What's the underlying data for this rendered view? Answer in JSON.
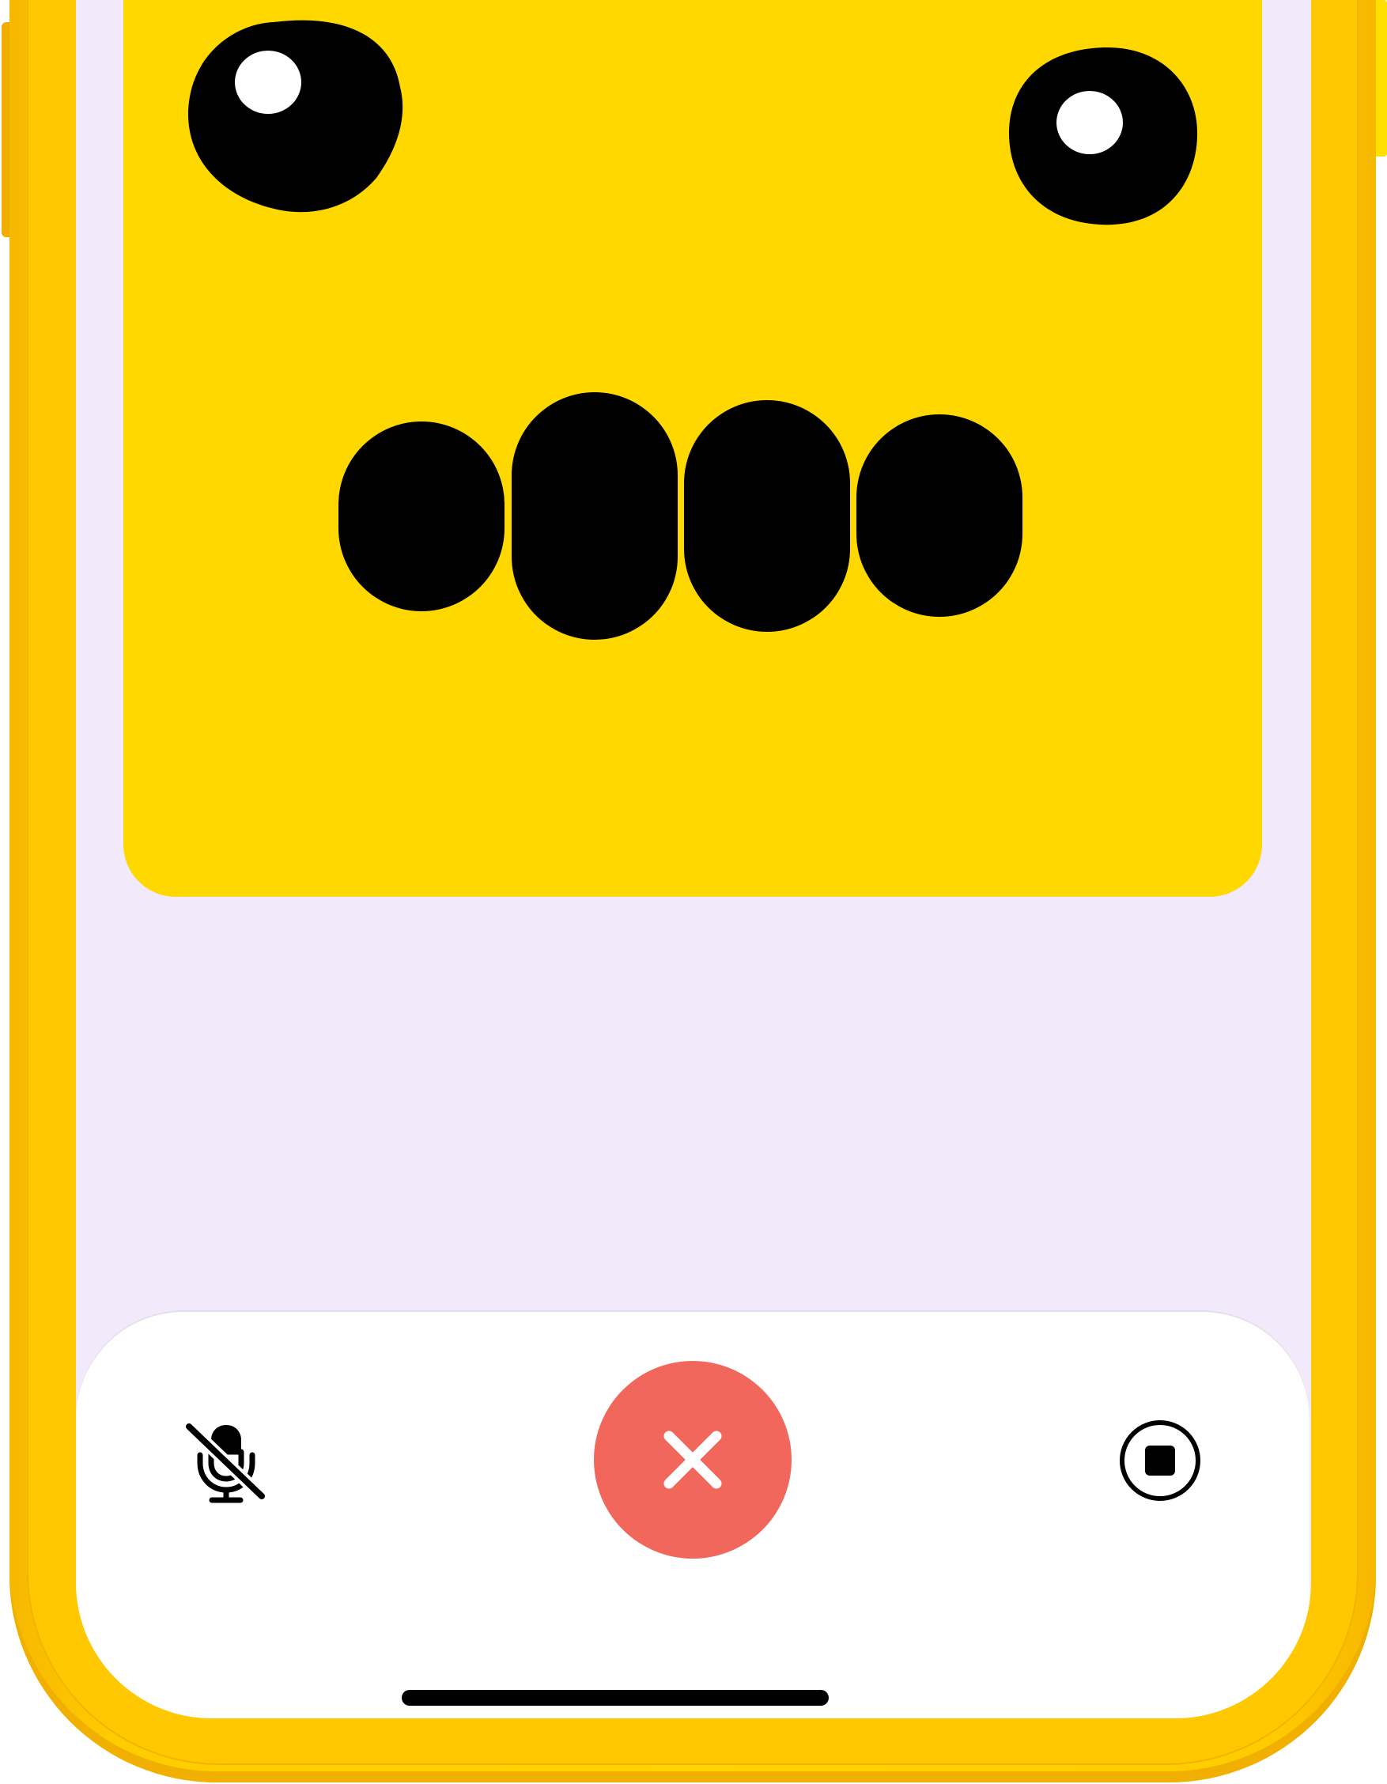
{
  "colors": {
    "frame": "#FFD400",
    "screen_background": "#F2EAFA",
    "face_card": "#FFD800",
    "face_features": "#000000",
    "eye_highlight": "#FFFFFF",
    "control_bar": "#FFFFFF",
    "end_call": "#F2675C",
    "end_call_icon": "#FFFFFF",
    "home_indicator": "#000000"
  },
  "icons": {
    "mute_microphone": "mic-off-icon",
    "end_call": "close-icon",
    "stop": "stop-circle-icon"
  }
}
